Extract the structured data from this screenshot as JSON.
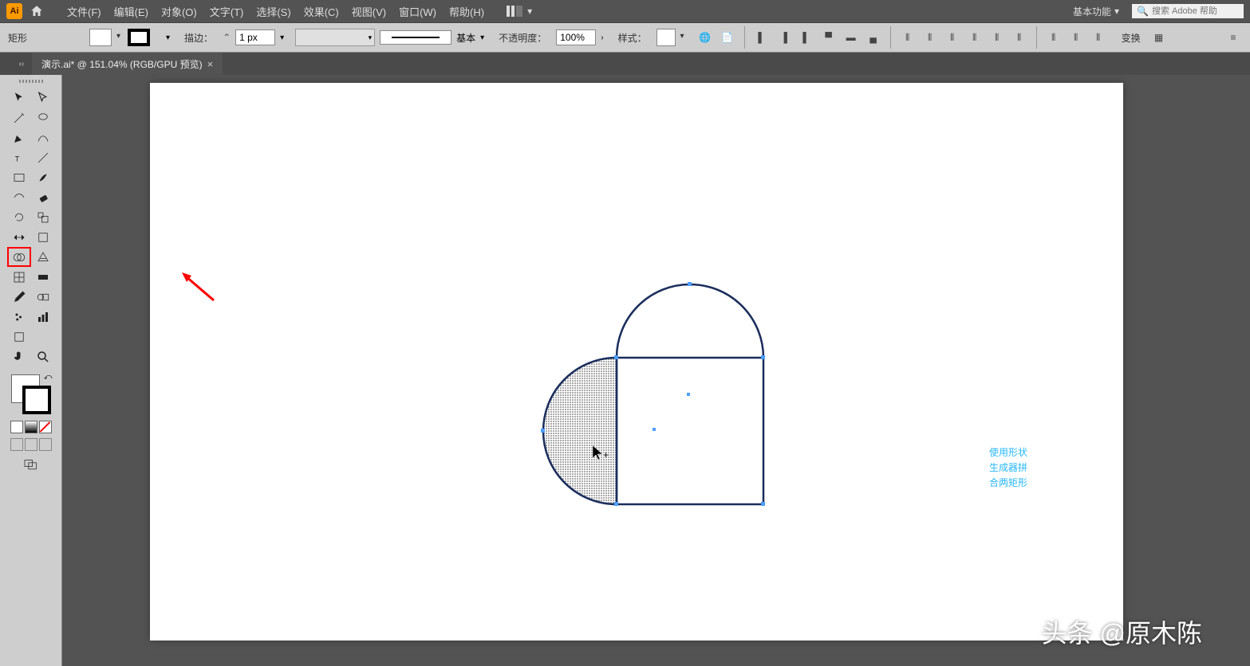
{
  "app": {
    "name": "Ai"
  },
  "menubar": {
    "items": [
      "文件(F)",
      "编辑(E)",
      "对象(O)",
      "文字(T)",
      "选择(S)",
      "效果(C)",
      "视图(V)",
      "窗口(W)",
      "帮助(H)"
    ],
    "workspace": "基本功能",
    "search_placeholder": "搜索 Adobe 帮助"
  },
  "control": {
    "shape_label": "矩形",
    "stroke_label": "描边：",
    "stroke_value": "1 px",
    "stroke_style_label": "基本",
    "opacity_label": "不透明度：",
    "opacity_value": "100%",
    "style_label": "样式：",
    "transform_label": "变换"
  },
  "tab": {
    "title": "演示.ai* @ 151.04% (RGB/GPU 预览)"
  },
  "annotation": {
    "line1": "使用形状",
    "line2": "生成器拼",
    "line3": "合两矩形"
  },
  "watermark": "头条 @原木陈"
}
